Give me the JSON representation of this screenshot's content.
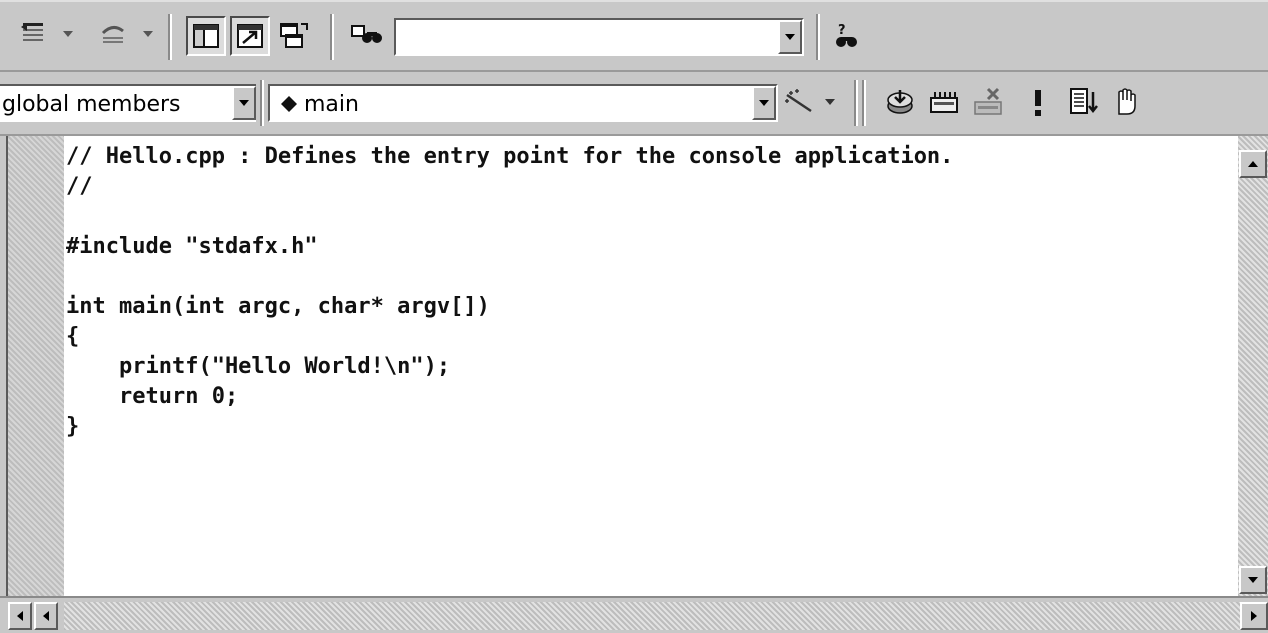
{
  "toolbar1": {
    "find_combo": {
      "value": ""
    }
  },
  "toolbar2": {
    "class_combo": {
      "value": "global members"
    },
    "member_combo": {
      "value": "main"
    }
  },
  "editor": {
    "lines": [
      "// Hello.cpp : Defines the entry point for the console application.",
      "//",
      "",
      "#include \"stdafx.h\"",
      "",
      "int main(int argc, char* argv[])",
      "{",
      "    printf(\"Hello World!\\n\");",
      "    return 0;",
      "}"
    ]
  },
  "icons": {
    "undo": "undo-icon",
    "redo": "redo-icon",
    "workspace": "workspace-icon",
    "output": "output-icon",
    "window_list": "window-list-icon",
    "find_in_files": "find-in-files-icon",
    "search": "search-binoculars-icon",
    "wizard": "wizard-wand-icon",
    "compile": "compile-icon",
    "build": "build-icon",
    "stop_build": "stop-build-icon",
    "execute": "execute-icon",
    "go": "go-icon",
    "breakpoint": "breakpoint-hand-icon"
  }
}
